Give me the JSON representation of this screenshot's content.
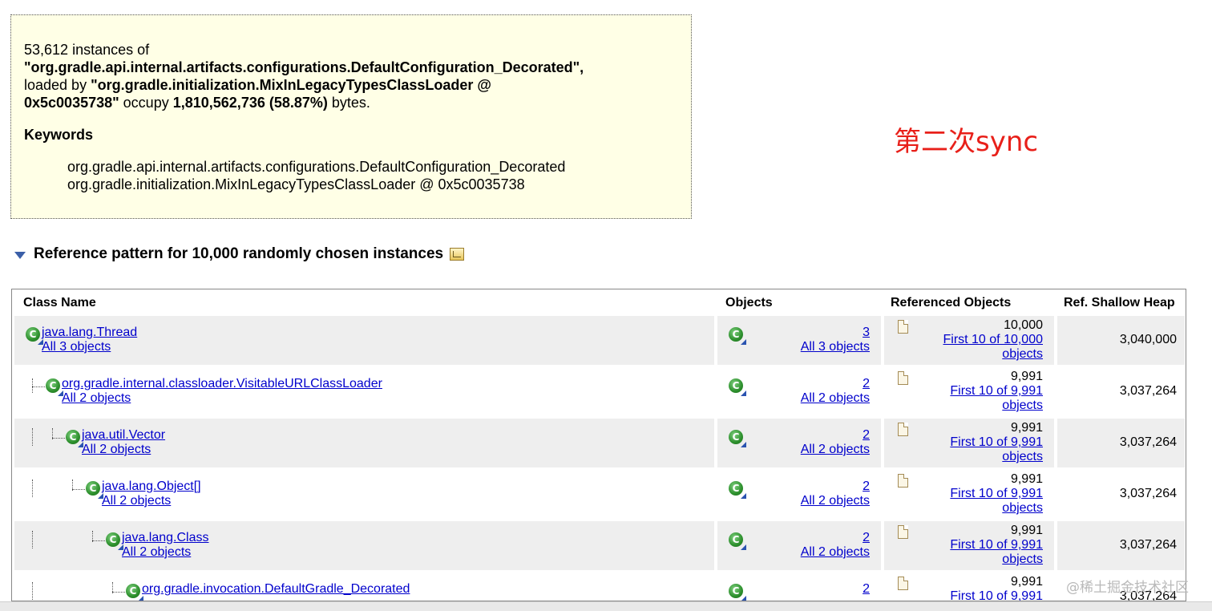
{
  "summary": {
    "count": "53,612",
    "text_instances_of": "instances of",
    "class_quoted": "\"org.gradle.api.internal.artifacts.configurations.DefaultConfiguration_Decorated\",",
    "text_loaded_by": "loaded by",
    "loader_quoted_part1": "\"org.gradle.initialization.MixInLegacyTypesClassLoader @",
    "loader_quoted_part2": "0x5c0035738\"",
    "text_occupy": "occupy",
    "size": "1,810,562,736 (58.87%)",
    "text_bytes": "bytes.",
    "keywords_title": "Keywords",
    "keywords": [
      "org.gradle.api.internal.artifacts.configurations.DefaultConfiguration_Decorated",
      "org.gradle.initialization.MixInLegacyTypesClassLoader @ 0x5c0035738"
    ]
  },
  "annotation": "第二次sync",
  "section": {
    "title": "Reference pattern for 10,000 randomly chosen instances"
  },
  "table": {
    "headers": {
      "class_name": "Class Name",
      "objects": "Objects",
      "referenced_objects": "Referenced Objects",
      "ref_shallow_heap": "Ref. Shallow Heap"
    },
    "rows": [
      {
        "class": "java.lang.Thread",
        "all": "All 3 objects",
        "objects": "3",
        "objects_all": "All 3 objects",
        "ref_count": "10,000",
        "ref_first": "First 10 of 10,000",
        "ref_objects": "objects",
        "heap": "3,040,000",
        "depth": 0
      },
      {
        "class": "org.gradle.internal.classloader.VisitableURLClassLoader",
        "all": "All 2 objects",
        "objects": "2",
        "objects_all": "All 2 objects",
        "ref_count": "9,991",
        "ref_first": "First 10 of 9,991",
        "ref_objects": "objects",
        "heap": "3,037,264",
        "depth": 1
      },
      {
        "class": "java.util.Vector",
        "all": "All 2 objects",
        "objects": "2",
        "objects_all": "All 2 objects",
        "ref_count": "9,991",
        "ref_first": "First 10 of 9,991",
        "ref_objects": "objects",
        "heap": "3,037,264",
        "depth": 2
      },
      {
        "class": "java.lang.Object[]",
        "all": "All 2 objects",
        "objects": "2",
        "objects_all": "All 2 objects",
        "ref_count": "9,991",
        "ref_first": "First 10 of 9,991",
        "ref_objects": "objects",
        "heap": "3,037,264",
        "depth": 3
      },
      {
        "class": "java.lang.Class",
        "all": "All 2 objects",
        "objects": "2",
        "objects_all": "All 2 objects",
        "ref_count": "9,991",
        "ref_first": "First 10 of 9,991",
        "ref_objects": "objects",
        "heap": "3,037,264",
        "depth": 4
      },
      {
        "class": "org.gradle.invocation.DefaultGradle_Decorated",
        "all": "",
        "objects": "2",
        "objects_all": "",
        "ref_count": "9,991",
        "ref_first": "First 10 of 9,991",
        "ref_objects": "",
        "heap": "3,037,264",
        "depth": 5
      }
    ]
  },
  "watermark": "@稀土掘金技术社区",
  "icons": {
    "class_icon": "class-c-icon",
    "doc_icon": "document-icon",
    "collapse_icon": "triangle-down-icon",
    "export_icon": "export-icon"
  }
}
